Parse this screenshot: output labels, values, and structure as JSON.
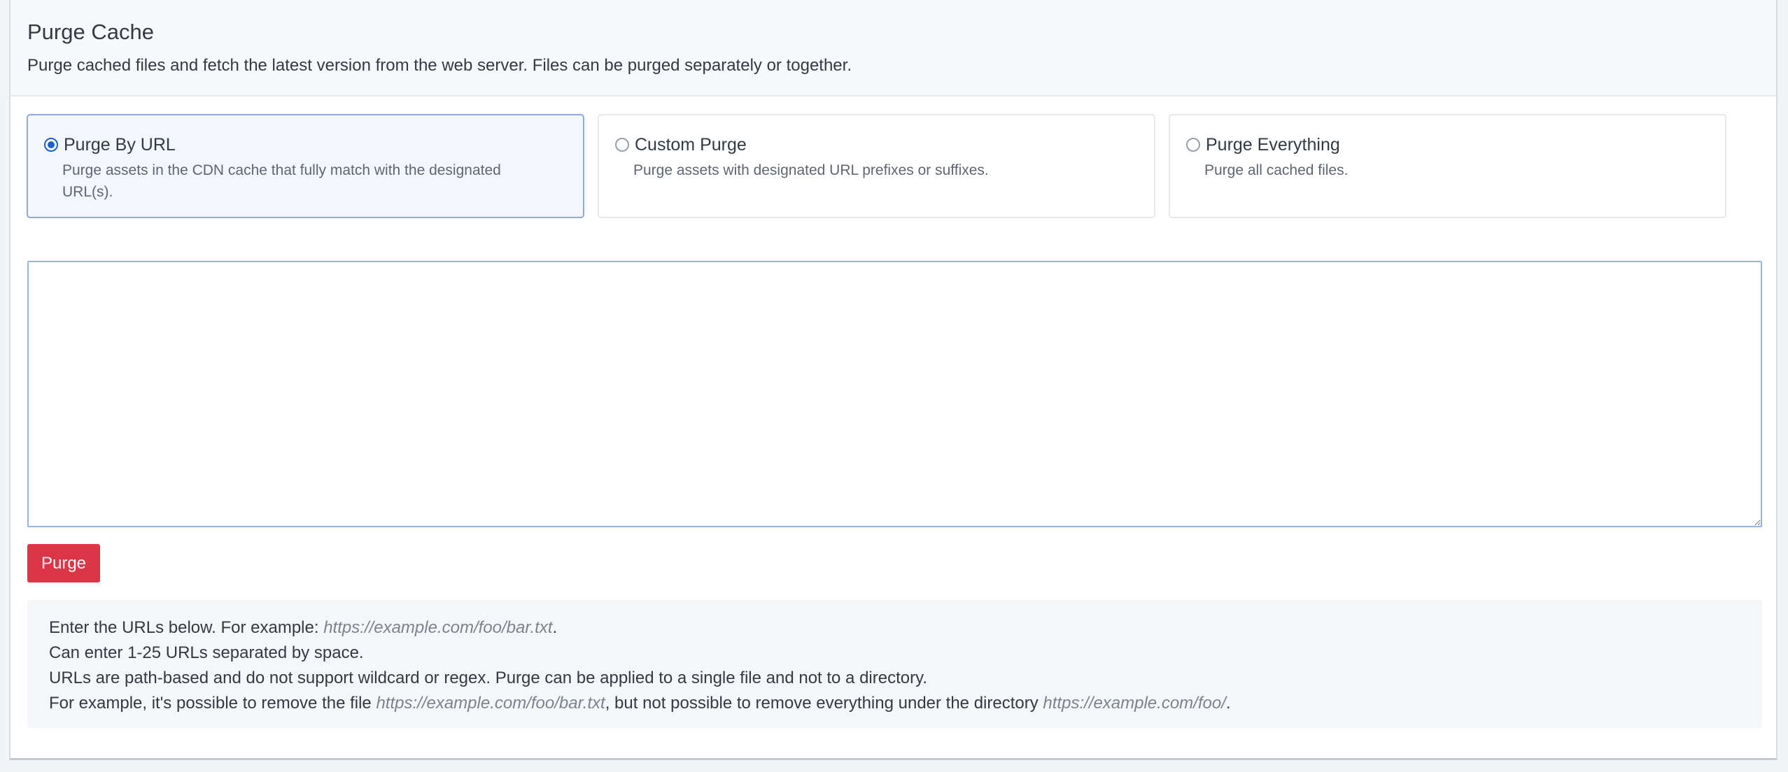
{
  "header": {
    "title": "Purge Cache",
    "subtitle": "Purge cached files and fetch the latest version from the web server. Files can be purged separately or together."
  },
  "options": [
    {
      "label": "Purge By URL",
      "description": "Purge assets in the CDN cache that fully match with the designated URL(s).",
      "selected": true
    },
    {
      "label": "Custom Purge",
      "description": "Purge assets with designated URL prefixes or suffixes.",
      "selected": false
    },
    {
      "label": "Purge Everything",
      "description": "Purge all cached files.",
      "selected": false
    }
  ],
  "url_input": {
    "value": "",
    "placeholder": ""
  },
  "purge_button": {
    "label": "Purge",
    "color": "#dc3545"
  },
  "help": {
    "line1_prefix": "Enter the URLs below. For example: ",
    "line1_example": "https://example.com/foo/bar.txt",
    "line1_suffix": ".",
    "line2": "Can enter 1-25 URLs separated by space.",
    "line3": "URLs are path-based and do not support wildcard or regex. Purge can be applied to a single file and not to a directory.",
    "line4_prefix": "For example, it's possible to remove the file ",
    "line4_example1": "https://example.com/foo/bar.txt",
    "line4_middle": ", but not possible to remove everything under the directory ",
    "line4_example2": "https://example.com/foo/",
    "line4_suffix": "."
  },
  "colors": {
    "accent": "#1a5fd1",
    "selected_border": "#8ea8e0",
    "selected_background": "#f3f6fc"
  }
}
